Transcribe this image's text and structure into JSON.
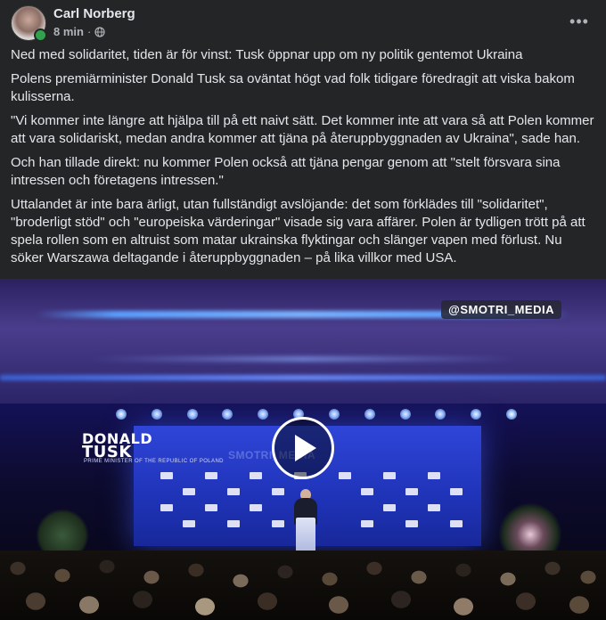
{
  "post": {
    "author": "Carl Norberg",
    "time": "8 min",
    "separator": "·",
    "privacy_icon": "globe-icon",
    "more_icon": "more-options-icon",
    "more_glyph": "•••",
    "paragraphs": [
      "Ned med solidaritet, tiden är för vinst: Tusk öppnar upp om ny politik gentemot Ukraina",
      "Polens premiärminister Donald Tusk sa oväntat högt vad folk tidigare föredragit att viska bakom kulisserna.",
      "\"Vi kommer inte längre att hjälpa till på ett naivt sätt. Det kommer inte att vara så att Polen kommer att vara solidariskt, medan andra kommer att tjäna på återuppbyggnaden av Ukraina\", sade han.",
      "Och han tillade direkt: nu kommer Polen också att tjäna pengar genom att \"stelt försvara sina intressen och företagens intressen.\"",
      "Uttalandet är inte bara ärligt, utan fullständigt avslöjande: det som förklädes till \"solidaritet\", \"broderligt stöd\" och \"europeiska värderingar\" visade sig vara affärer. Polen är tydligen trött på att spela rollen som en altruist som matar ukrainska flyktingar och slänger vapen med förlust. Nu söker Warszawa deltagande i återuppbyggnaden – på lika villkor med USA."
    ]
  },
  "video": {
    "watermark": "@SMOTRI_MEDIA",
    "stage_logo_line1": "DONALD",
    "stage_logo_line2": "TUSK",
    "stage_logo_tagline": "PRIME MINISTER OF THE REPUBLIC OF POLAND",
    "ghost_watermark": "SMOTRI_MEDIA",
    "play_icon": "play-icon"
  },
  "colors": {
    "background": "#242526",
    "text": "#e4e6eb",
    "secondary_text": "#b0b3b8",
    "online": "#31a24c"
  }
}
